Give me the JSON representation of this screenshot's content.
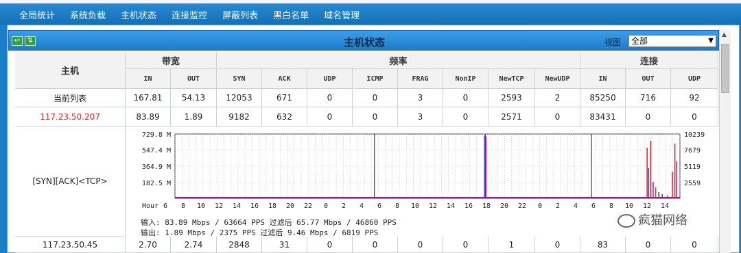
{
  "nav": {
    "items": [
      "全局统计",
      "系统负载",
      "主机状态",
      "连接监控",
      "屏蔽列表",
      "黑白名单",
      "域名管理"
    ]
  },
  "panel": {
    "title": "主机状态",
    "view_label": "视图",
    "view_value": "全部",
    "icons": [
      "back-arrow-icon",
      "refresh-icon"
    ]
  },
  "table": {
    "header": {
      "host": "主机",
      "bandwidth": "带宽",
      "frequency": "频率",
      "connection": "连接"
    },
    "sub_headers": [
      "IN",
      "OUT",
      "SYN",
      "ACK",
      "UDP",
      "ICMP",
      "FRAG",
      "NonIP",
      "NewTCP",
      "NewUDP",
      "IN",
      "OUT",
      "UDP"
    ],
    "rows": [
      {
        "host": "当前列表",
        "values": [
          "167.81",
          "54.13",
          "12053",
          "671",
          "0",
          "0",
          "3",
          "0",
          "2593",
          "2",
          "85250",
          "716",
          "92"
        ]
      },
      {
        "host": "117.23.50.207",
        "values": [
          "83.89",
          "1.89",
          "9182",
          "632",
          "0",
          "0",
          "3",
          "0",
          "2571",
          "0",
          "83431",
          "0",
          "0"
        ]
      },
      {
        "host": "117.23.50.45",
        "values": [
          "2.70",
          "2.74",
          "2848",
          "31",
          "0",
          "0",
          "0",
          "0",
          "1",
          "0",
          "83",
          "0",
          "0"
        ]
      }
    ],
    "graph_row_label": "[SYN][ACK]<TCP>",
    "graph_in_text": "输入: 83.89 Mbps / 63664 PPS 过滤后 65.77 Mbps / 46860 PPS",
    "graph_out_text": "输出: 1.89 Mbps / 2375 PPS 过滤后 9.46 Mbps / 6819 PPS"
  },
  "chart_data": {
    "type": "line",
    "xlabel": "Hour",
    "x_ticks": [
      "6",
      "8",
      "10",
      "12",
      "14",
      "16",
      "18",
      "20",
      "22",
      "0",
      "2",
      "4",
      "6",
      "8",
      "10",
      "12",
      "14",
      "16",
      "18",
      "20",
      "22",
      "0",
      "2",
      "4",
      "6",
      "8",
      "10",
      "12",
      "14"
    ],
    "y_left_ticks": [
      "729.8 M",
      "547.4 M",
      "364.9 M",
      "182.5 M"
    ],
    "y_right_ticks": [
      "10239",
      "7679",
      "5119",
      "2559"
    ],
    "grid": true,
    "colors": {
      "spike_blue": "#3a3ad8",
      "spike_red": "#e01a2a",
      "spike_purple": "#b21ab0",
      "spike_green": "#1a9a2a",
      "baseline": "#c000c0"
    }
  }
}
